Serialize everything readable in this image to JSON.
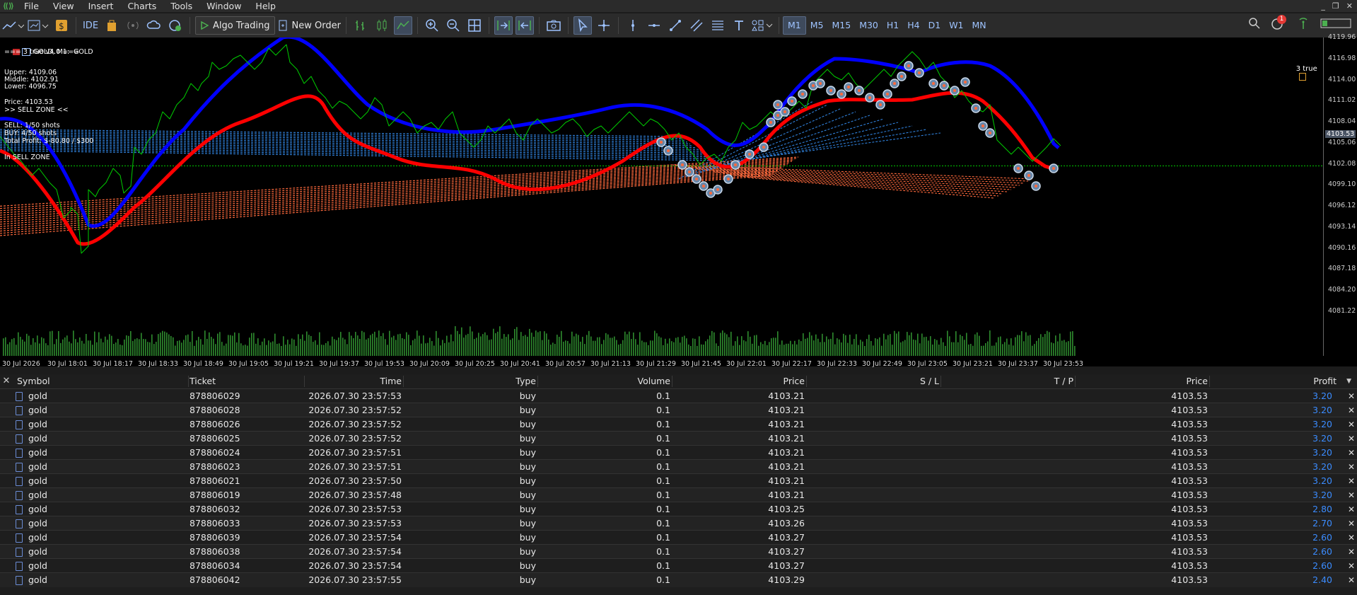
{
  "menu": [
    "File",
    "View",
    "Insert",
    "Charts",
    "Tools",
    "Window",
    "Help"
  ],
  "toolbar": {
    "ide": "IDE",
    "algo": "Algo Trading",
    "new_order": "New Order",
    "timeframes": [
      "M1",
      "M5",
      "M15",
      "M30",
      "H1",
      "H4",
      "D1",
      "W1",
      "MN"
    ],
    "active_timeframe": "M1",
    "notif_count": "1"
  },
  "chart": {
    "header": "GOLD, M1:  GOLD",
    "indicator_title": "=== 3 true v4.0 ===",
    "upper": "Upper: 4109.06",
    "middle": "Middle: 4102.91",
    "lower": "Lower: 4096.75",
    "price": "Price: 4103.53",
    "zone": ">> SELL ZONE <<",
    "sell_shots": "SELL: 1/50 shots",
    "buy_shots": "BUY: 4/50 shots",
    "total_profit": "Total Profit: $-80.80 / $300",
    "in_zone": "In SELL ZONE",
    "ea_name": "3 true",
    "current_price": "4103.53",
    "price_ticks": [
      "4119.96",
      "4116.98",
      "4114.00",
      "4111.02",
      "4108.04",
      "4105.06",
      "4102.08",
      "4099.10",
      "4096.12",
      "4093.14",
      "4090.16",
      "4087.18",
      "4084.20",
      "4081.22"
    ],
    "time_ticks": [
      "30 Jul 2026",
      "30 Jul 18:01",
      "30 Jul 18:17",
      "30 Jul 18:33",
      "30 Jul 18:49",
      "30 Jul 19:05",
      "30 Jul 19:21",
      "30 Jul 19:37",
      "30 Jul 19:53",
      "30 Jul 20:09",
      "30 Jul 20:25",
      "30 Jul 20:41",
      "30 Jul 20:57",
      "30 Jul 21:13",
      "30 Jul 21:29",
      "30 Jul 21:45",
      "30 Jul 22:01",
      "30 Jul 22:17",
      "30 Jul 22:33",
      "30 Jul 22:49",
      "30 Jul 23:05",
      "30 Jul 23:21",
      "30 Jul 23:37",
      "30 Jul 23:53"
    ],
    "colors": {
      "upper": "#0000ff",
      "lower": "#ff0000",
      "price": "#00cc00",
      "bid": "#00cc00"
    }
  },
  "table": {
    "headers": [
      "Symbol",
      "Ticket",
      "Time",
      "Type",
      "Volume",
      "Price",
      "S / L",
      "T / P",
      "Price",
      "Profit"
    ],
    "rows": [
      [
        "gold",
        "878806029",
        "2026.07.30 23:57:53",
        "buy",
        "0.1",
        "4103.21",
        "",
        "",
        "4103.53",
        "3.20"
      ],
      [
        "gold",
        "878806028",
        "2026.07.30 23:57:52",
        "buy",
        "0.1",
        "4103.21",
        "",
        "",
        "4103.53",
        "3.20"
      ],
      [
        "gold",
        "878806026",
        "2026.07.30 23:57:52",
        "buy",
        "0.1",
        "4103.21",
        "",
        "",
        "4103.53",
        "3.20"
      ],
      [
        "gold",
        "878806025",
        "2026.07.30 23:57:52",
        "buy",
        "0.1",
        "4103.21",
        "",
        "",
        "4103.53",
        "3.20"
      ],
      [
        "gold",
        "878806024",
        "2026.07.30 23:57:51",
        "buy",
        "0.1",
        "4103.21",
        "",
        "",
        "4103.53",
        "3.20"
      ],
      [
        "gold",
        "878806023",
        "2026.07.30 23:57:51",
        "buy",
        "0.1",
        "4103.21",
        "",
        "",
        "4103.53",
        "3.20"
      ],
      [
        "gold",
        "878806021",
        "2026.07.30 23:57:50",
        "buy",
        "0.1",
        "4103.21",
        "",
        "",
        "4103.53",
        "3.20"
      ],
      [
        "gold",
        "878806019",
        "2026.07.30 23:57:48",
        "buy",
        "0.1",
        "4103.21",
        "",
        "",
        "4103.53",
        "3.20"
      ],
      [
        "gold",
        "878806032",
        "2026.07.30 23:57:53",
        "buy",
        "0.1",
        "4103.25",
        "",
        "",
        "4103.53",
        "2.80"
      ],
      [
        "gold",
        "878806033",
        "2026.07.30 23:57:53",
        "buy",
        "0.1",
        "4103.26",
        "",
        "",
        "4103.53",
        "2.70"
      ],
      [
        "gold",
        "878806039",
        "2026.07.30 23:57:54",
        "buy",
        "0.1",
        "4103.27",
        "",
        "",
        "4103.53",
        "2.60"
      ],
      [
        "gold",
        "878806038",
        "2026.07.30 23:57:54",
        "buy",
        "0.1",
        "4103.27",
        "",
        "",
        "4103.53",
        "2.60"
      ],
      [
        "gold",
        "878806034",
        "2026.07.30 23:57:54",
        "buy",
        "0.1",
        "4103.27",
        "",
        "",
        "4103.53",
        "2.60"
      ],
      [
        "gold",
        "878806042",
        "2026.07.30 23:57:55",
        "buy",
        "0.1",
        "4103.29",
        "",
        "",
        "4103.53",
        "2.40"
      ]
    ]
  }
}
